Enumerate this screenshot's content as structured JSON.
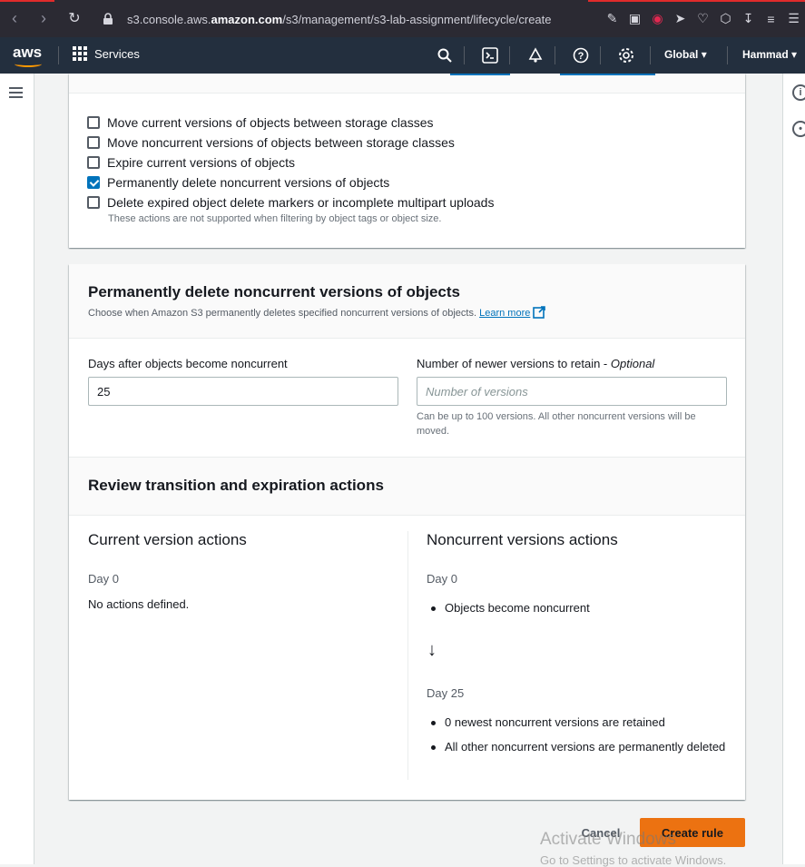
{
  "browser": {
    "url_prefix": "s3.console.aws.",
    "url_domain": "amazon.com",
    "url_path": "/s3/management/s3-lab-assignment/lifecycle/create"
  },
  "aws": {
    "services_label": "Services",
    "region_label": "Global",
    "user_label": "Hammad"
  },
  "actions": {
    "options": [
      {
        "label": "Move current versions of objects between storage classes",
        "checked": false
      },
      {
        "label": "Move noncurrent versions of objects between storage classes",
        "checked": false
      },
      {
        "label": "Expire current versions of objects",
        "checked": false
      },
      {
        "label": "Permanently delete noncurrent versions of objects",
        "checked": true
      },
      {
        "label": "Delete expired object delete markers or incomplete multipart uploads",
        "checked": false
      }
    ],
    "hint": "These actions are not supported when filtering by object tags or object size."
  },
  "permanent_delete": {
    "title": "Permanently delete noncurrent versions of objects",
    "description": "Choose when Amazon S3 permanently deletes specified noncurrent versions of objects.",
    "learn_more": "Learn more",
    "days_label": "Days after objects become noncurrent",
    "days_value": "25",
    "retain_label": "Number of newer versions to retain -",
    "retain_optional": "Optional",
    "retain_placeholder": "Number of versions",
    "retain_hint": "Can be up to 100 versions. All other noncurrent versions will be moved."
  },
  "review": {
    "title": "Review transition and expiration actions",
    "current": {
      "heading": "Current version actions",
      "day": "Day 0",
      "text": "No actions defined."
    },
    "noncurrent": {
      "heading": "Noncurrent versions actions",
      "day0": "Day 0",
      "day0_item": "Objects become noncurrent",
      "arrow": "↓",
      "day25": "Day 25",
      "day25_items": [
        "0 newest noncurrent versions are retained",
        "All other noncurrent versions are permanently deleted"
      ]
    }
  },
  "footer": {
    "cancel": "Cancel",
    "create": "Create rule",
    "watermark_title": "Activate Windows",
    "watermark_sub": "Go to Settings to activate Windows."
  },
  "colors": {
    "primary_button": "#ec7211",
    "link": "#0073bb",
    "aws_header": "#232f3e",
    "browser_bar": "#2b2a33"
  }
}
